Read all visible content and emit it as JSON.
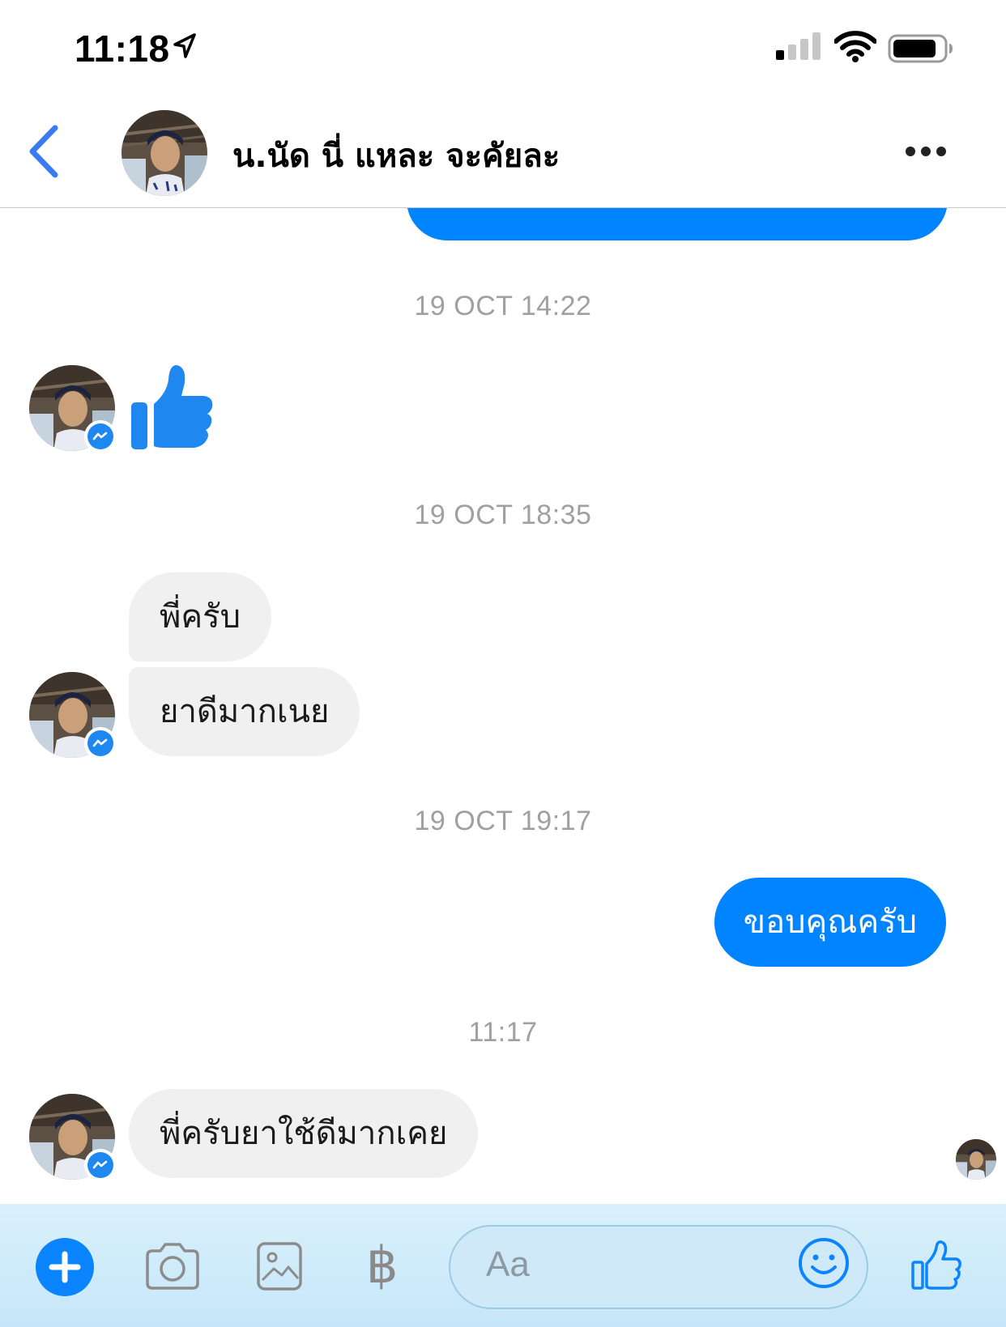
{
  "status_bar": {
    "time": "11:18"
  },
  "header": {
    "contact_name": "น.นัด นี่ แหละ จะคัยละ",
    "back_icon": "chevron-left-icon",
    "more_icon": "ellipsis-icon"
  },
  "messages": {
    "ts1": "19 OCT 14:22",
    "ts2": "19 OCT 18:35",
    "ts3": "19 OCT 19:17",
    "ts4": "11:17",
    "in_1": "พี่ครับ",
    "in_2": "ยาดีมากเนย",
    "out_1": "ขอบคุณครับ",
    "in_3": "พี่ครับยาใช้ดีมากเคย",
    "sticker": "thumbs-up-icon"
  },
  "composer": {
    "placeholder": "Aa",
    "currency_symbol": "฿"
  },
  "colors": {
    "accent": "#0084ff",
    "incoming_bubble": "#f0f0f0",
    "timestamp": "#a0a0a0"
  }
}
